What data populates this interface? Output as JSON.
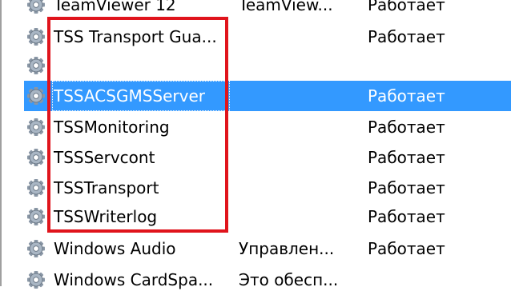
{
  "services": [
    {
      "name": "TeamViewer 12",
      "description": "TeamView...",
      "status": "Работает",
      "selected": false
    },
    {
      "name": "TSS Transport Gua...",
      "description": "",
      "status": "Работает",
      "selected": false
    },
    {
      "name": "",
      "description": "",
      "status": "",
      "selected": false
    },
    {
      "name": "TSSACSGMSServer",
      "description": "",
      "status": "Работает",
      "selected": true
    },
    {
      "name": "TSSMonitoring",
      "description": "",
      "status": "Работает",
      "selected": false
    },
    {
      "name": "TSSServcont",
      "description": "",
      "status": "Работает",
      "selected": false
    },
    {
      "name": "TSSTransport",
      "description": "",
      "status": "Работает",
      "selected": false
    },
    {
      "name": "TSSWriterlog",
      "description": "",
      "status": "Работает",
      "selected": false
    },
    {
      "name": "Windows Audio",
      "description": "Управлен...",
      "status": "Работает",
      "selected": false
    },
    {
      "name": "Windows CardSpa...",
      "description": "Это обесп...",
      "status": "",
      "selected": false
    }
  ],
  "colors": {
    "selection": "#3399ff",
    "annotation_box": "#e0141c"
  },
  "icon": "gear-icon"
}
